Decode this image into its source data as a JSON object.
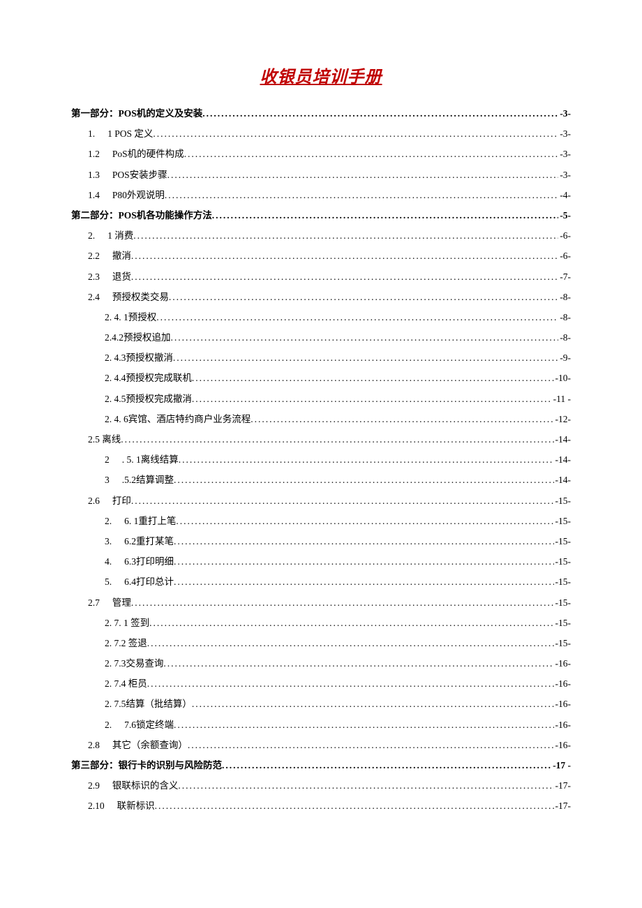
{
  "title": "收银员培训手册",
  "toc": [
    {
      "level": 1,
      "num": "",
      "text": "第一部分：POS机的定义及安装",
      "page": "-3-"
    },
    {
      "level": 2,
      "num": "1.",
      "text": "1 POS 定义",
      "page": "-3-"
    },
    {
      "level": 2,
      "num": "1.2",
      "text": "PoS机的硬件构成",
      "page": "-3-"
    },
    {
      "level": 2,
      "num": "1.3",
      "text": "POS安装步骤",
      "page": "-3-"
    },
    {
      "level": 2,
      "num": "1.4",
      "text": "P80外观说明",
      "page": "-4-"
    },
    {
      "level": 1,
      "num": "",
      "text": "第二部分：POS机各功能操作方法",
      "page": "-5-"
    },
    {
      "level": 2,
      "num": "2.",
      "text": "1 消费",
      "page": "-6-"
    },
    {
      "level": 2,
      "num": "2.2",
      "text": "撤消",
      "page": "-6-"
    },
    {
      "level": 2,
      "num": "2.3",
      "text": "退货",
      "page": "-7-"
    },
    {
      "level": 2,
      "num": "2.4",
      "text": "预授权类交易",
      "page": "-8-"
    },
    {
      "level": 3,
      "num": "",
      "text": "2. 4. 1预授权",
      "page": "-8-"
    },
    {
      "level": 3,
      "num": "",
      "text": "2.4.2预授权追加",
      "page": "-8-"
    },
    {
      "level": 3,
      "num": "",
      "text": "2. 4.3预授权撤消",
      "page": "-9-"
    },
    {
      "level": 3,
      "num": "",
      "text": "2. 4.4预授权完成联机",
      "page": "-10-"
    },
    {
      "level": 3,
      "num": "",
      "text": "2. 4.5预授权完成撤消",
      "page": "-11 -"
    },
    {
      "level": 3,
      "num": "",
      "text": "2. 4. 6宾馆、酒店特约商户业务流程",
      "page": "-12-"
    },
    {
      "level": 2,
      "num": "",
      "text": "2.5 离线",
      "page": "-14-"
    },
    {
      "level": 3,
      "num": "2",
      "text": ". 5. 1离线结算",
      "page": "-14-"
    },
    {
      "level": 3,
      "num": "3",
      "text": ".5.2结算调整",
      "page": "-14-"
    },
    {
      "level": 2,
      "num": "2.6",
      "text": "打印",
      "page": "-15-"
    },
    {
      "level": 3,
      "num": "2.",
      "text": "6. 1重打上笔",
      "page": "-15-"
    },
    {
      "level": 3,
      "num": "3.",
      "text": "6.2重打某笔",
      "page": "-15-"
    },
    {
      "level": 3,
      "num": "4.",
      "text": "6.3打印明细",
      "page": "-15-"
    },
    {
      "level": 3,
      "num": "5.",
      "text": "6.4打印总计",
      "page": "-15-"
    },
    {
      "level": 2,
      "num": "2.7",
      "text": "管理",
      "page": "-15-"
    },
    {
      "level": 3,
      "num": "",
      "text": "2. 7. 1 签到",
      "page": "-15-"
    },
    {
      "level": 3,
      "num": "",
      "text": "2. 7.2 签退",
      "page": "-15-"
    },
    {
      "level": 3,
      "num": "",
      "text": "2. 7.3交易查询",
      "page": "-16-"
    },
    {
      "level": 3,
      "num": "",
      "text": "2. 7.4 柜员",
      "page": "-16-"
    },
    {
      "level": 3,
      "num": "",
      "text": "2. 7.5结算（批结算）",
      "page": "-16-"
    },
    {
      "level": 3,
      "num": "2.",
      "text": "7.6锁定终端",
      "page": "-16-"
    },
    {
      "level": 2,
      "num": "2.8",
      "text": "其它（余额查询）",
      "page": "-16-"
    },
    {
      "level": 1,
      "num": "",
      "text": "第三部分：银行卡的识别与风险防范",
      "page": "-17 -"
    },
    {
      "level": 2,
      "num": "2.9",
      "text": "银联标识的含义",
      "page": "-17-"
    },
    {
      "level": 2,
      "num": "2.10",
      "text": "联新标识",
      "page": "-17-"
    }
  ]
}
